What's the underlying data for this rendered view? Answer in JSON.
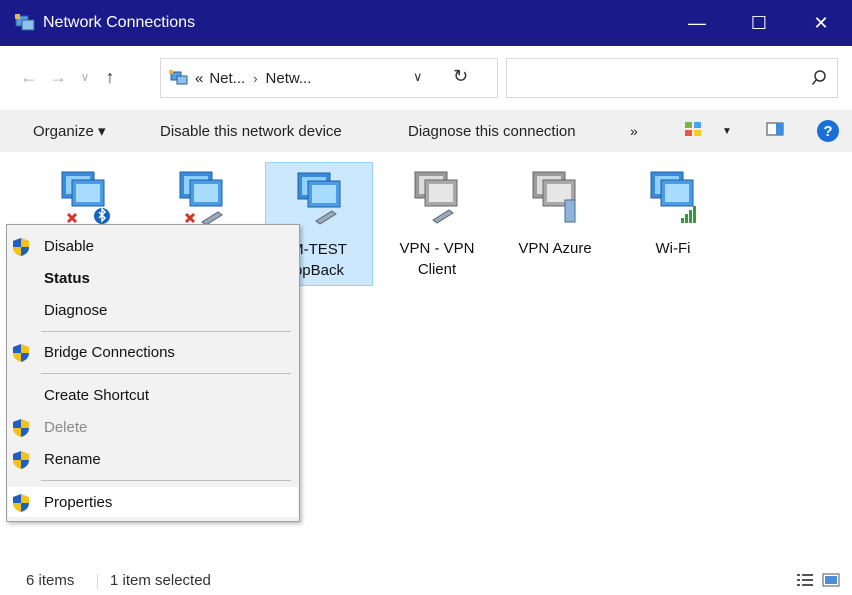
{
  "window": {
    "title": "Network Connections",
    "min_glyph": "—",
    "max_glyph": "☐",
    "close_glyph": "✕"
  },
  "addressbar": {
    "back_glyph": "←",
    "forward_glyph": "→",
    "recent_glyph": "∨",
    "up_glyph": "↑",
    "prefix": "«",
    "crumbs": [
      "Net...",
      "Netw..."
    ],
    "crumb_sep": "›",
    "dropdown_glyph": "∨",
    "refresh_glyph": "↻",
    "search_placeholder": ""
  },
  "commandbar": {
    "organize": "Organize ▾",
    "disable": "Disable this network device",
    "diagnose": "Diagnose this connection",
    "more": "»",
    "view_dd": "▼",
    "help": "?"
  },
  "items": [
    {
      "label": "",
      "icon": "network-adapter-bluetooth-disabled-icon"
    },
    {
      "label": "",
      "icon": "network-adapter-ethernet-disabled-icon"
    },
    {
      "label": "M-TEST\nopBack",
      "line1": "M-TEST",
      "line2": "opBack",
      "selected": true,
      "icon": "network-adapter-ethernet-icon"
    },
    {
      "label": "VPN - VPN Client",
      "line1": "VPN - VPN",
      "line2": "Client",
      "icon": "network-adapter-vpn-icon"
    },
    {
      "label": "VPN Azure",
      "line1": "VPN Azure",
      "line2": "",
      "icon": "network-adapter-vpn-server-icon"
    },
    {
      "label": "Wi-Fi",
      "line1": "Wi-Fi",
      "line2": "",
      "icon": "network-adapter-wifi-icon"
    }
  ],
  "context_menu": {
    "items": [
      {
        "label": "Disable",
        "shield": true
      },
      {
        "label": "Status",
        "bold": true
      },
      {
        "label": "Diagnose"
      },
      {
        "label": "Bridge Connections",
        "shield": true
      },
      {
        "label": "Create Shortcut"
      },
      {
        "label": "Delete",
        "shield": true,
        "disabled": true
      },
      {
        "label": "Rename",
        "shield": true
      },
      {
        "label": "Properties",
        "shield": true,
        "hover": true
      }
    ]
  },
  "statusbar": {
    "count": "6 items",
    "selection": "1 item selected"
  },
  "colors": {
    "titlebar": "#1a1a8a",
    "selection": "#cce8ff",
    "help": "#1a6fd6"
  }
}
